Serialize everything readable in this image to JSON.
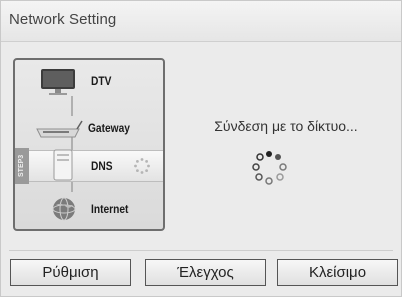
{
  "dialog": {
    "title": "Network Setting",
    "status_text": "Σύνδεση με το δίκτυο..."
  },
  "steps": [
    {
      "label": "DTV",
      "icon": "tv-icon"
    },
    {
      "label": "Gateway",
      "icon": "router-icon"
    },
    {
      "label": "DNS",
      "icon": "server-icon",
      "active": true,
      "tab_label": "STEP3"
    },
    {
      "label": "Internet",
      "icon": "globe-icon"
    }
  ],
  "buttons": {
    "setup": "Ρύθμιση",
    "test": "Έλεγχος",
    "close": "Κλείσιμο"
  }
}
